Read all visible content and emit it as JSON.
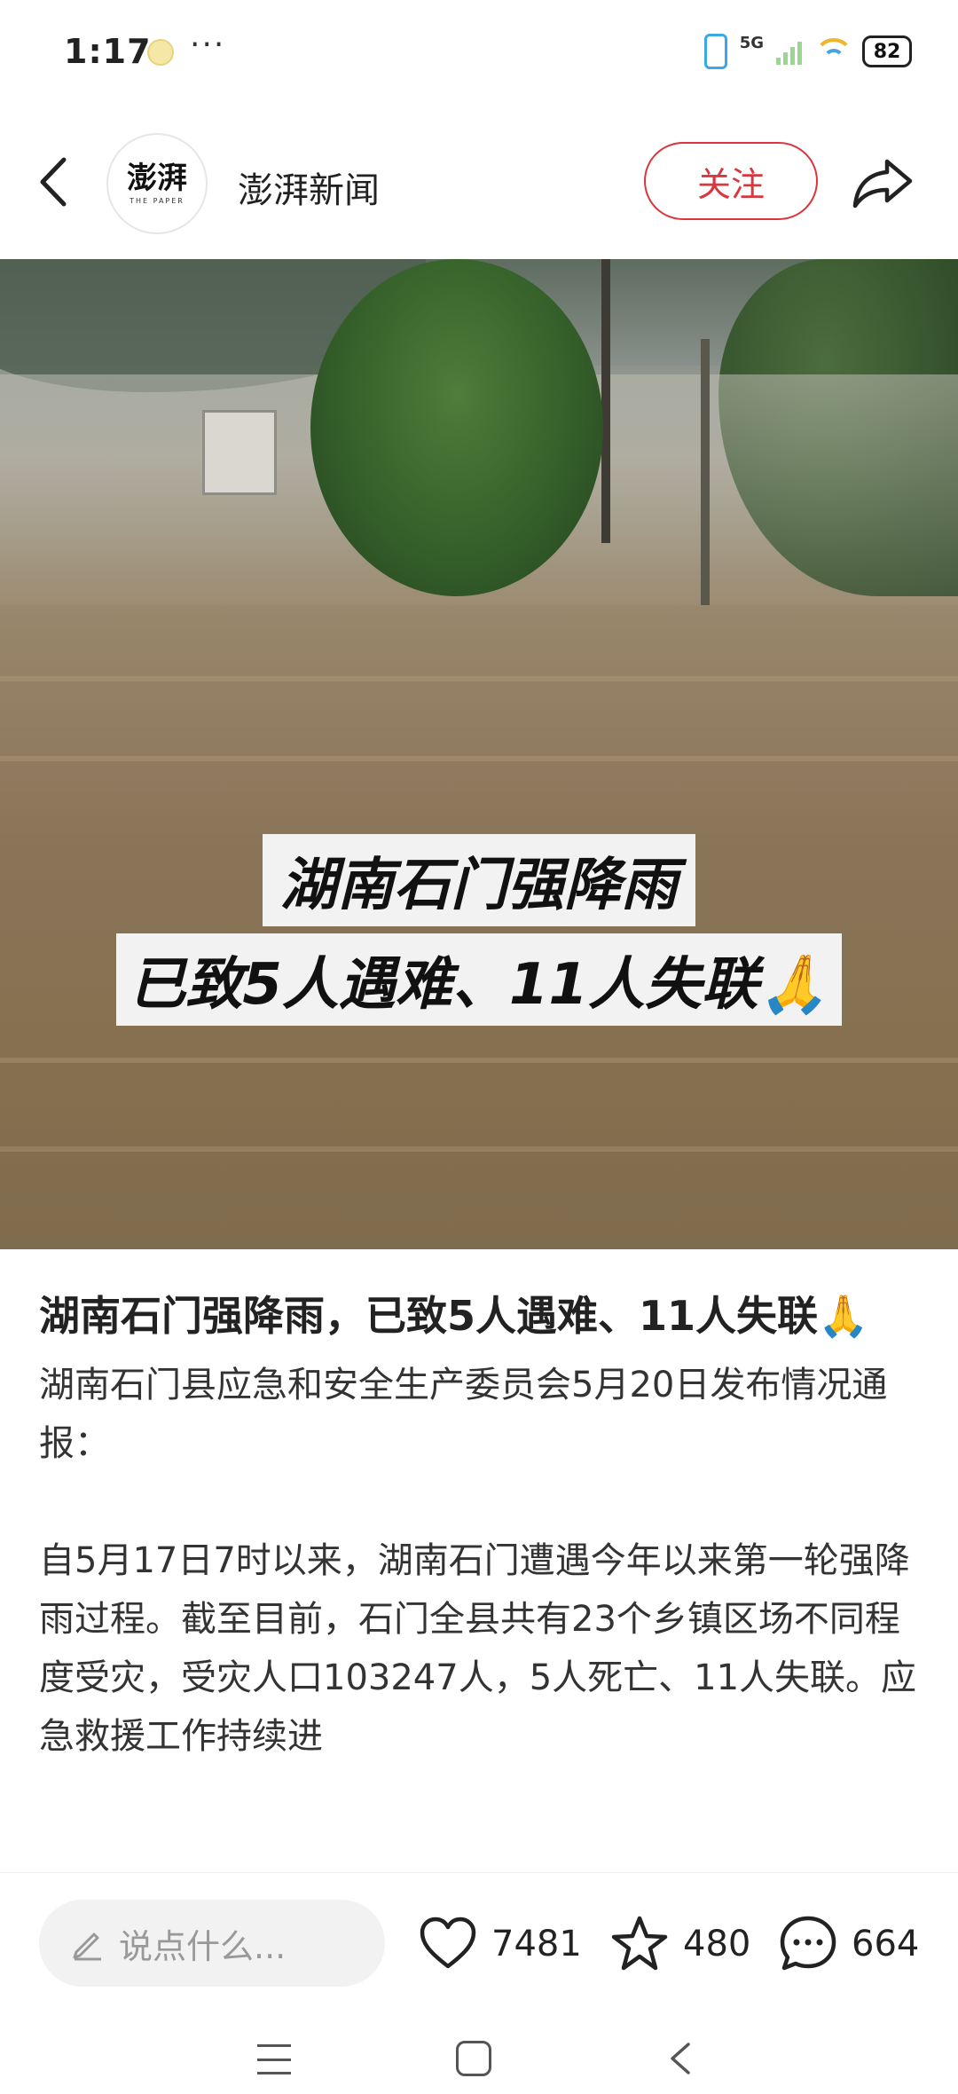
{
  "status_bar": {
    "time": "1:17",
    "more": "···",
    "network": "5G",
    "battery": "82"
  },
  "header": {
    "logo_text": "澎湃",
    "logo_sub": "THE PAPER",
    "channel_name": "澎湃新闻",
    "follow_label": "关注"
  },
  "hero": {
    "caption_line1": "湖南石门强降雨",
    "caption_line2": "已致5人遇难、11人失联🙏"
  },
  "article": {
    "title": "湖南石门强降雨，已致5人遇难、11人失联🙏",
    "paragraph1": "湖南石门县应急和安全生产委员会5月20日发布情况通报：",
    "paragraph2": "自5月17日7时以来，湖南石门遭遇今年以来第一轮强降雨过程。截至目前，石门全县共有23个乡镇区场不同程度受灾，受灾人口103247人，5人死亡、11人失联。应急救援工作持续进"
  },
  "bottom_bar": {
    "comment_placeholder": "说点什么...",
    "likes": "7481",
    "favorites": "480",
    "comments": "664"
  },
  "colors": {
    "accent": "#d9363e",
    "text": "#222222",
    "placeholder": "#999999"
  },
  "icons": [
    "back-icon",
    "share-icon",
    "pen-icon",
    "heart-icon",
    "star-icon",
    "comment-bubble-icon"
  ]
}
